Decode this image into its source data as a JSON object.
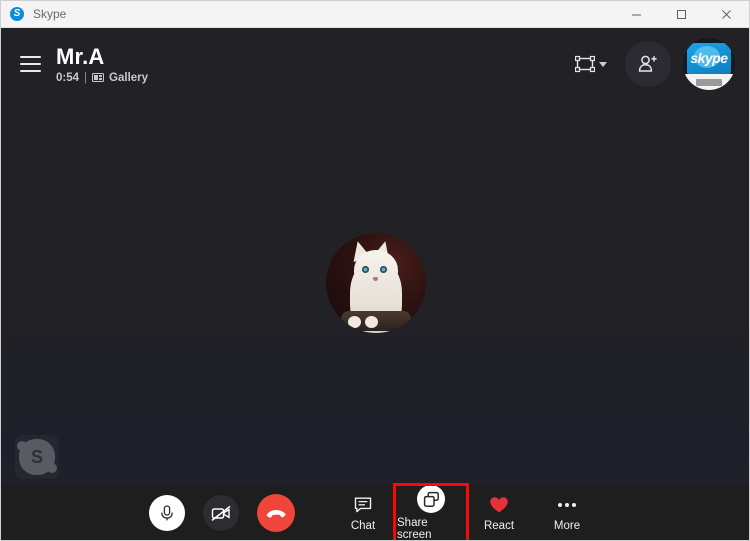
{
  "window": {
    "app_name": "Skype",
    "logo_letter": "S",
    "controls": {
      "minimize": "minimize-button",
      "maximize": "maximize-button",
      "close": "close-button"
    }
  },
  "call": {
    "contact_name": "Mr.A",
    "duration": "0:54",
    "separator": "|",
    "view_mode": "Gallery",
    "self_initial": "S",
    "avatar_word": "skype"
  },
  "header_actions": {
    "menu": "hamburger-menu",
    "layout": "layout-switch",
    "add_people": "add-people",
    "profile": "profile-avatar"
  },
  "controls": {
    "mic": "Mute",
    "camera": "Start video",
    "end_call": "End call",
    "chat_label": "Chat",
    "share_label": "Share screen",
    "react_label": "React",
    "more_label": "More"
  },
  "colors": {
    "brand_blue": "#0a8ddc",
    "end_call_red": "#f0453a",
    "react_red": "#e8303a",
    "highlight_red": "#fa0707",
    "stage_bg": "#222226",
    "bar_bg": "#1e1e1f"
  }
}
